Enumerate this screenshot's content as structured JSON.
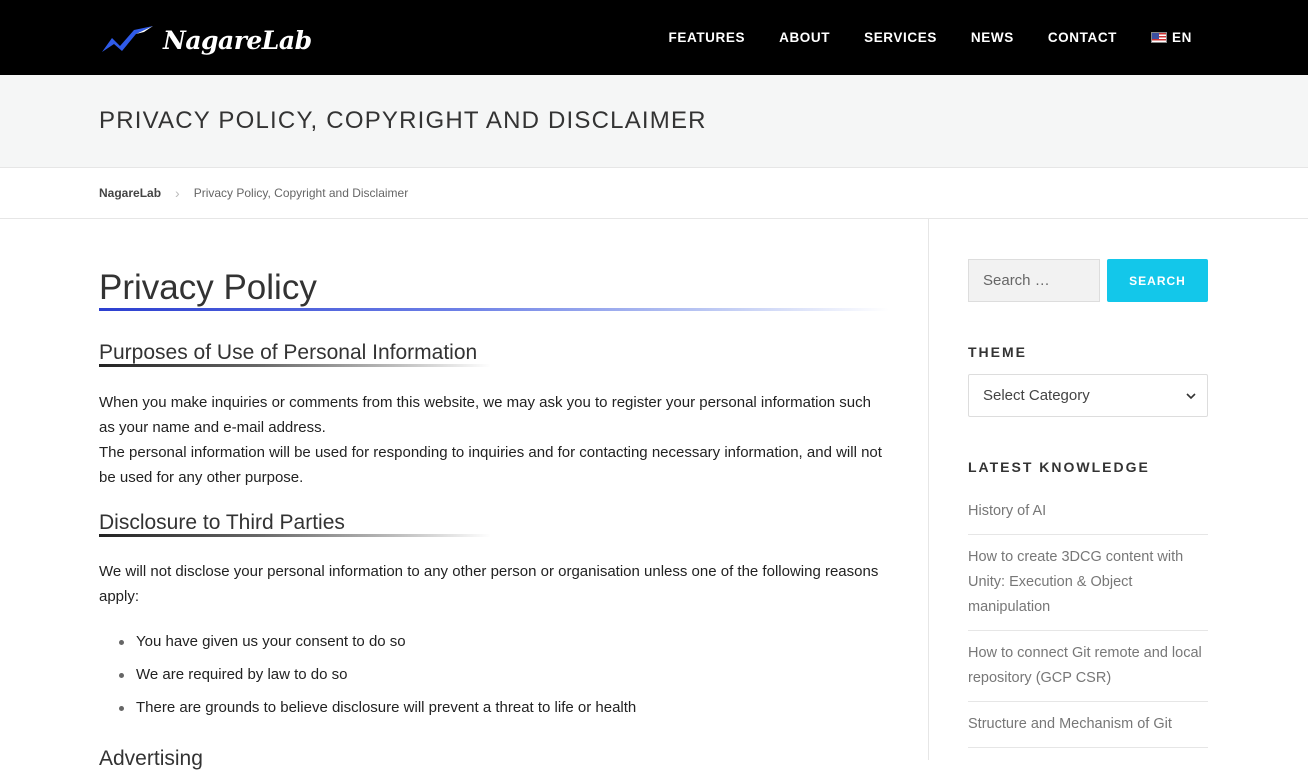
{
  "header": {
    "logo_text": "NagareLab",
    "nav": [
      {
        "label": "FEATURES"
      },
      {
        "label": "ABOUT"
      },
      {
        "label": "SERVICES"
      },
      {
        "label": "NEWS"
      },
      {
        "label": "CONTACT"
      },
      {
        "label": "EN",
        "icon": "us-flag-icon"
      }
    ],
    "logo_colors": {
      "mark": "#2f5bea",
      "text": "#ffffff"
    }
  },
  "page_title": "PRIVACY POLICY, COPYRIGHT AND DISCLAIMER",
  "breadcrumb": {
    "home": "NagareLab",
    "separator": "›",
    "current": "Privacy Policy, Copyright and Disclaimer"
  },
  "article": {
    "heading": "Privacy Policy",
    "sections": [
      {
        "title": "Purposes of Use of Personal Information",
        "paragraphs": [
          "When you make inquiries or comments from this website, we may ask you to register your personal information such as your name and e-mail address.",
          "The personal information will be used for responding to inquiries and for contacting necessary information, and will not be used for any other purpose."
        ]
      },
      {
        "title": "Disclosure to Third Parties",
        "paragraphs": [
          "We will not disclose your personal information to any other person or organisation unless one of the following reasons apply:"
        ],
        "list": [
          "You have given us your consent to do so",
          "We are required by law to do so",
          "There are grounds to believe disclosure will prevent a threat to life or health"
        ]
      },
      {
        "title": "Advertising"
      }
    ]
  },
  "sidebar": {
    "search": {
      "placeholder": "Search …",
      "button": "SEARCH",
      "button_color": "#13c7ea"
    },
    "theme": {
      "title": "THEME",
      "selected": "Select Category"
    },
    "latest": {
      "title": "LATEST KNOWLEDGE",
      "items": [
        "History of AI",
        "How to create 3DCG content with Unity: Execution & Object manipulation",
        "How to connect Git remote and local repository (GCP CSR)",
        "Structure and Mechanism of Git"
      ]
    }
  }
}
